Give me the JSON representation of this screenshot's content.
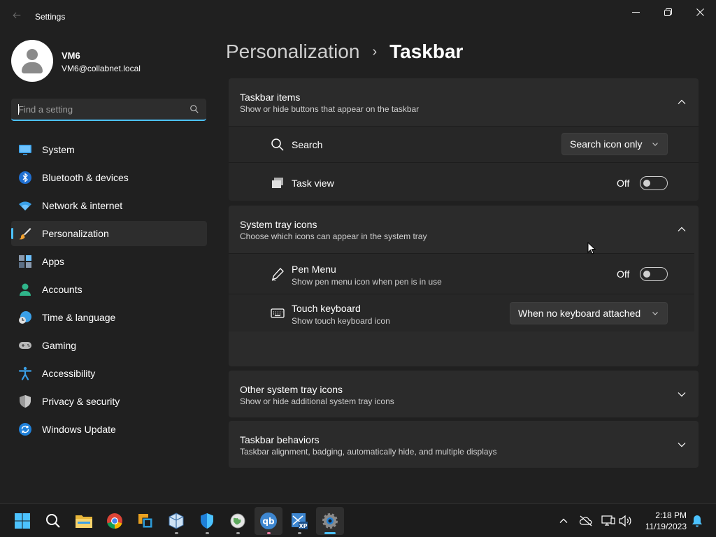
{
  "window": {
    "title": "Settings"
  },
  "profile": {
    "name": "VM6",
    "email": "VM6@collabnet.local"
  },
  "search": {
    "placeholder": "Find a setting",
    "value": ""
  },
  "sidebar": {
    "items": [
      {
        "label": "System",
        "icon": "system-icon",
        "active": false
      },
      {
        "label": "Bluetooth & devices",
        "icon": "bluetooth-icon",
        "active": false
      },
      {
        "label": "Network & internet",
        "icon": "network-icon",
        "active": false
      },
      {
        "label": "Personalization",
        "icon": "personalization-icon",
        "active": true
      },
      {
        "label": "Apps",
        "icon": "apps-icon",
        "active": false
      },
      {
        "label": "Accounts",
        "icon": "accounts-icon",
        "active": false
      },
      {
        "label": "Time & language",
        "icon": "time-language-icon",
        "active": false
      },
      {
        "label": "Gaming",
        "icon": "gaming-icon",
        "active": false
      },
      {
        "label": "Accessibility",
        "icon": "accessibility-icon",
        "active": false
      },
      {
        "label": "Privacy & security",
        "icon": "privacy-icon",
        "active": false
      },
      {
        "label": "Windows Update",
        "icon": "windows-update-icon",
        "active": false
      }
    ]
  },
  "breadcrumb": {
    "parent": "Personalization",
    "separator": "›",
    "current": "Taskbar"
  },
  "sections": {
    "taskbar_items": {
      "title": "Taskbar items",
      "subtitle": "Show or hide buttons that appear on the taskbar",
      "expanded": true,
      "rows": {
        "search": {
          "label": "Search",
          "icon": "search-icon",
          "value": "Search icon only"
        },
        "task_view": {
          "label": "Task view",
          "icon": "task-view-icon",
          "state_label": "Off",
          "on": false
        }
      }
    },
    "system_tray_icons": {
      "title": "System tray icons",
      "subtitle": "Choose which icons can appear in the system tray",
      "expanded": true,
      "rows": {
        "pen_menu": {
          "label": "Pen Menu",
          "sublabel": "Show pen menu icon when pen is in use",
          "icon": "pen-icon",
          "state_label": "Off",
          "on": false
        },
        "touch_keyboard": {
          "label": "Touch keyboard",
          "sublabel": "Show touch keyboard icon",
          "icon": "keyboard-icon",
          "value": "When no keyboard attached"
        }
      }
    },
    "other_tray_icons": {
      "title": "Other system tray icons",
      "subtitle": "Show or hide additional system tray icons",
      "expanded": false
    },
    "taskbar_behaviors": {
      "title": "Taskbar behaviors",
      "subtitle": "Taskbar alignment, badging, automatically hide, and multiple displays",
      "expanded": false
    }
  },
  "taskbar": {
    "apps": [
      "start-icon",
      "search-icon",
      "file-explorer-icon",
      "chrome-icon",
      "network-app-icon",
      "virtualbox-icon",
      "windows-security-icon",
      "browser-globe-icon",
      "qbittorrent-icon",
      "xp-mode-icon",
      "settings-icon"
    ],
    "clock": {
      "time": "2:18 PM",
      "date": "11/19/2023"
    }
  },
  "colors": {
    "accent": "#4cc2ff",
    "background": "#202020",
    "card": "#2b2b2b"
  }
}
